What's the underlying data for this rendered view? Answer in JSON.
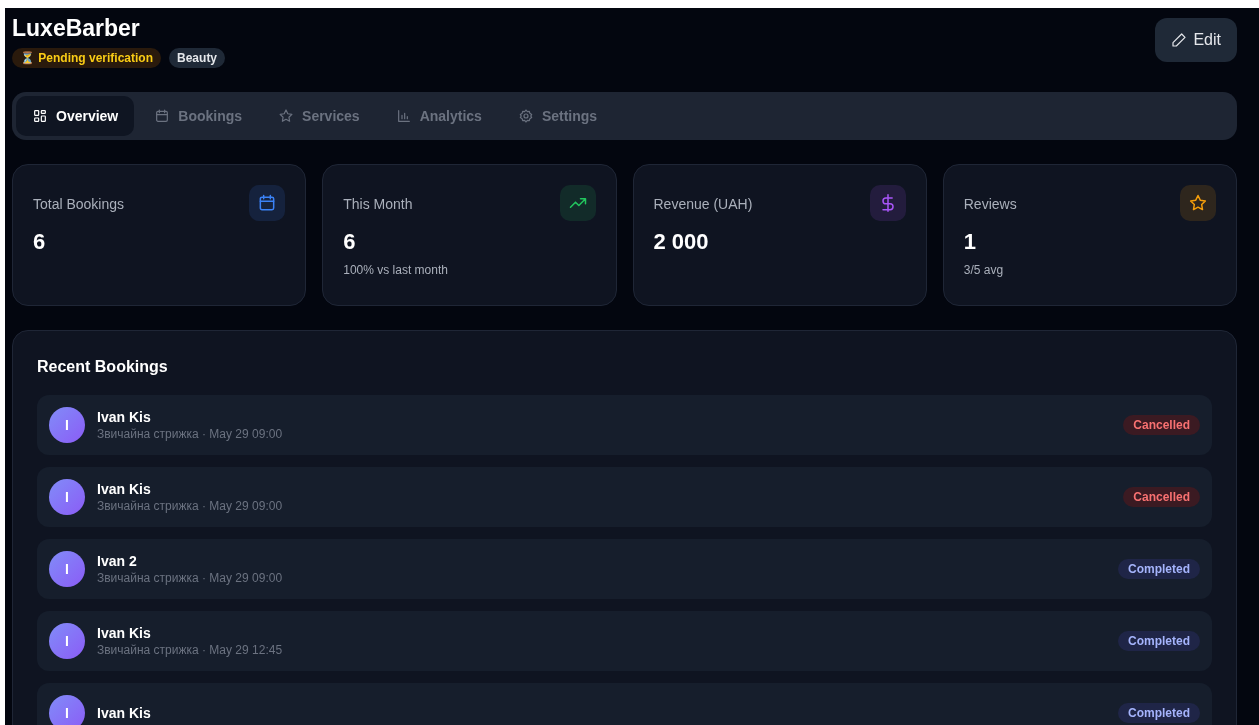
{
  "business": {
    "name": "LuxeBarber",
    "badges": [
      {
        "kind": "pending",
        "icon": "⏳",
        "label": "Pending verification"
      },
      {
        "kind": "category",
        "label": "Beauty"
      }
    ]
  },
  "edit_button": {
    "label": "Edit"
  },
  "tabs": [
    {
      "label": "Overview",
      "kind": "grid",
      "selected": true
    },
    {
      "label": "Bookings",
      "kind": "calendar",
      "selected": false
    },
    {
      "label": "Services",
      "kind": "star",
      "selected": false
    },
    {
      "label": "Analytics",
      "kind": "bars",
      "selected": false
    },
    {
      "label": "Settings",
      "kind": "gear",
      "selected": false
    }
  ],
  "stats": [
    {
      "label": "Total Bookings",
      "value": "6",
      "kind": "calendar",
      "color": "#3b82f6"
    },
    {
      "label": "This Month",
      "value": "6",
      "note": "100% vs last month",
      "kind": "trend",
      "color": "#22c55e"
    },
    {
      "label": "Revenue (UAH)",
      "value": "2 000",
      "kind": "dollar",
      "color": "#a855f7"
    },
    {
      "label": "Reviews",
      "value": "1",
      "note": "3/5 avg",
      "kind": "star",
      "color": "#f59e0b"
    }
  ],
  "recent_bookings": {
    "title": "Recent Bookings",
    "rows": [
      {
        "initial": "I",
        "name": "Ivan Kis",
        "detail": "Звичайна стрижка · May 29 09:00",
        "status": {
          "kind": "cancelled",
          "label": "Cancelled"
        }
      },
      {
        "initial": "I",
        "name": "Ivan Kis",
        "detail": "Звичайна стрижка · May 29 09:00",
        "status": {
          "kind": "cancelled",
          "label": "Cancelled"
        }
      },
      {
        "initial": "I",
        "name": "Ivan 2",
        "detail": "Звичайна стрижка · May 29 09:00",
        "status": {
          "kind": "completed",
          "label": "Completed"
        }
      },
      {
        "initial": "I",
        "name": "Ivan Kis",
        "detail": "Звичайна стрижка · May 29 12:45",
        "status": {
          "kind": "completed",
          "label": "Completed"
        }
      },
      {
        "initial": "I",
        "name": "Ivan Kis",
        "status": {
          "kind": "completed",
          "label": "Completed"
        }
      }
    ]
  }
}
